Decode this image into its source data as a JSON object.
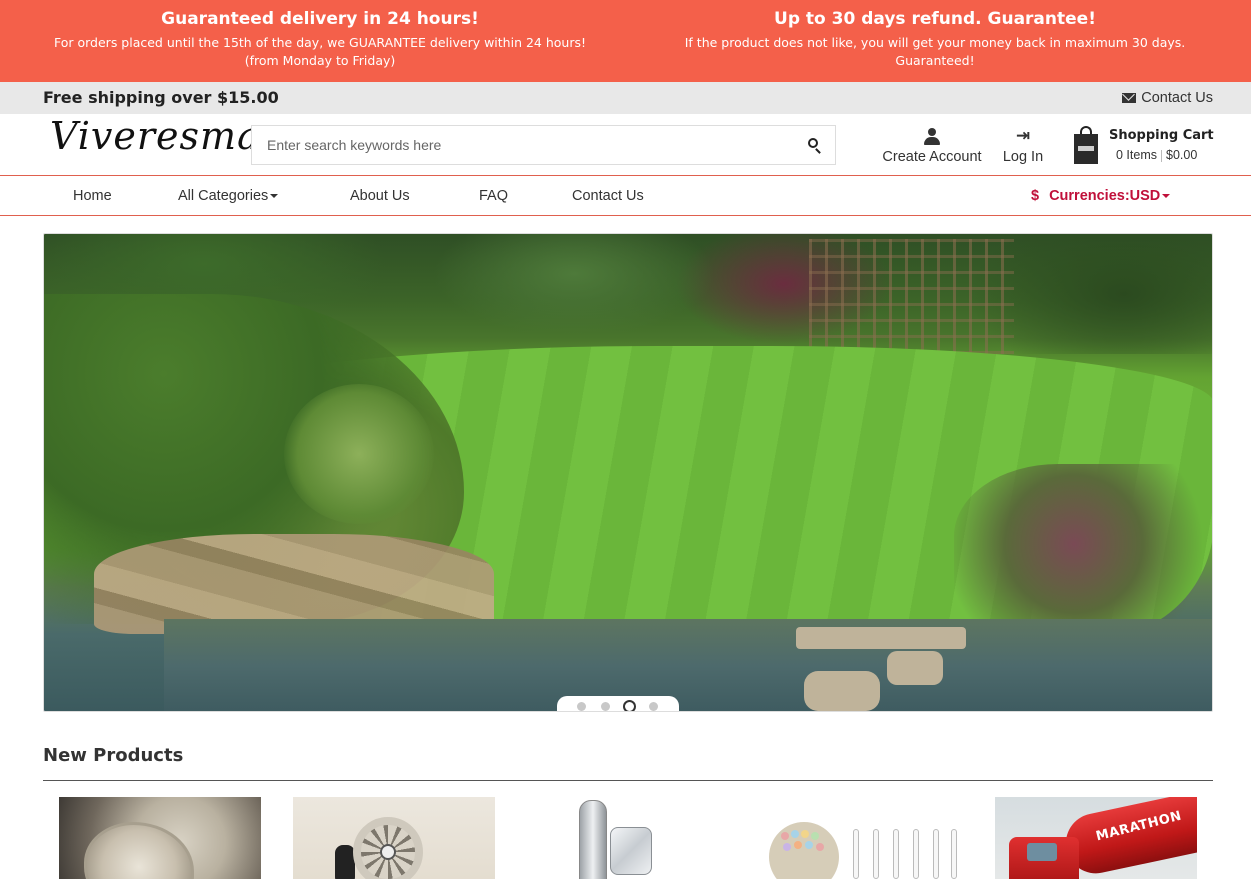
{
  "promo": {
    "left_title": "Guaranteed delivery in 24 hours!",
    "left_text": "For orders placed until the 15th of the day, we GUARANTEE delivery within 24 hours! (from Monday to Friday)",
    "right_title": "Up to 30 days refund. Guarantee!",
    "right_text": "If the product does not like, you will get your money back in maximum 30 days. Guaranteed!",
    "background_color": "#f4604a"
  },
  "topbar": {
    "shipping_text": "Free shipping over $15.00",
    "contact_label": "Contact Us",
    "contact_icon": "envelope-icon"
  },
  "header": {
    "logo_text": "Viveresma",
    "search_placeholder": "Enter search keywords here",
    "search_icon": "search-icon",
    "create_account_label": "Create Account",
    "login_label": "Log In",
    "login_icon_glyph": "⇥",
    "cart_title": "Shopping Cart",
    "cart_items": "0 Items",
    "cart_total": "$0.00"
  },
  "nav": {
    "items": [
      {
        "label": "Home"
      },
      {
        "label": "All Categories"
      },
      {
        "label": "About Us"
      },
      {
        "label": "FAQ"
      },
      {
        "label": "Contact Us"
      }
    ],
    "currency_symbol": "$",
    "currency_label": "Currencies:USD",
    "accent_color": "#c0103a",
    "border_color": "#e0604e"
  },
  "slider": {
    "slide_count": 4,
    "active_slide": 3
  },
  "new_products": {
    "title": "New Products"
  },
  "product_images": {
    "truck_label": "MARATHON"
  }
}
